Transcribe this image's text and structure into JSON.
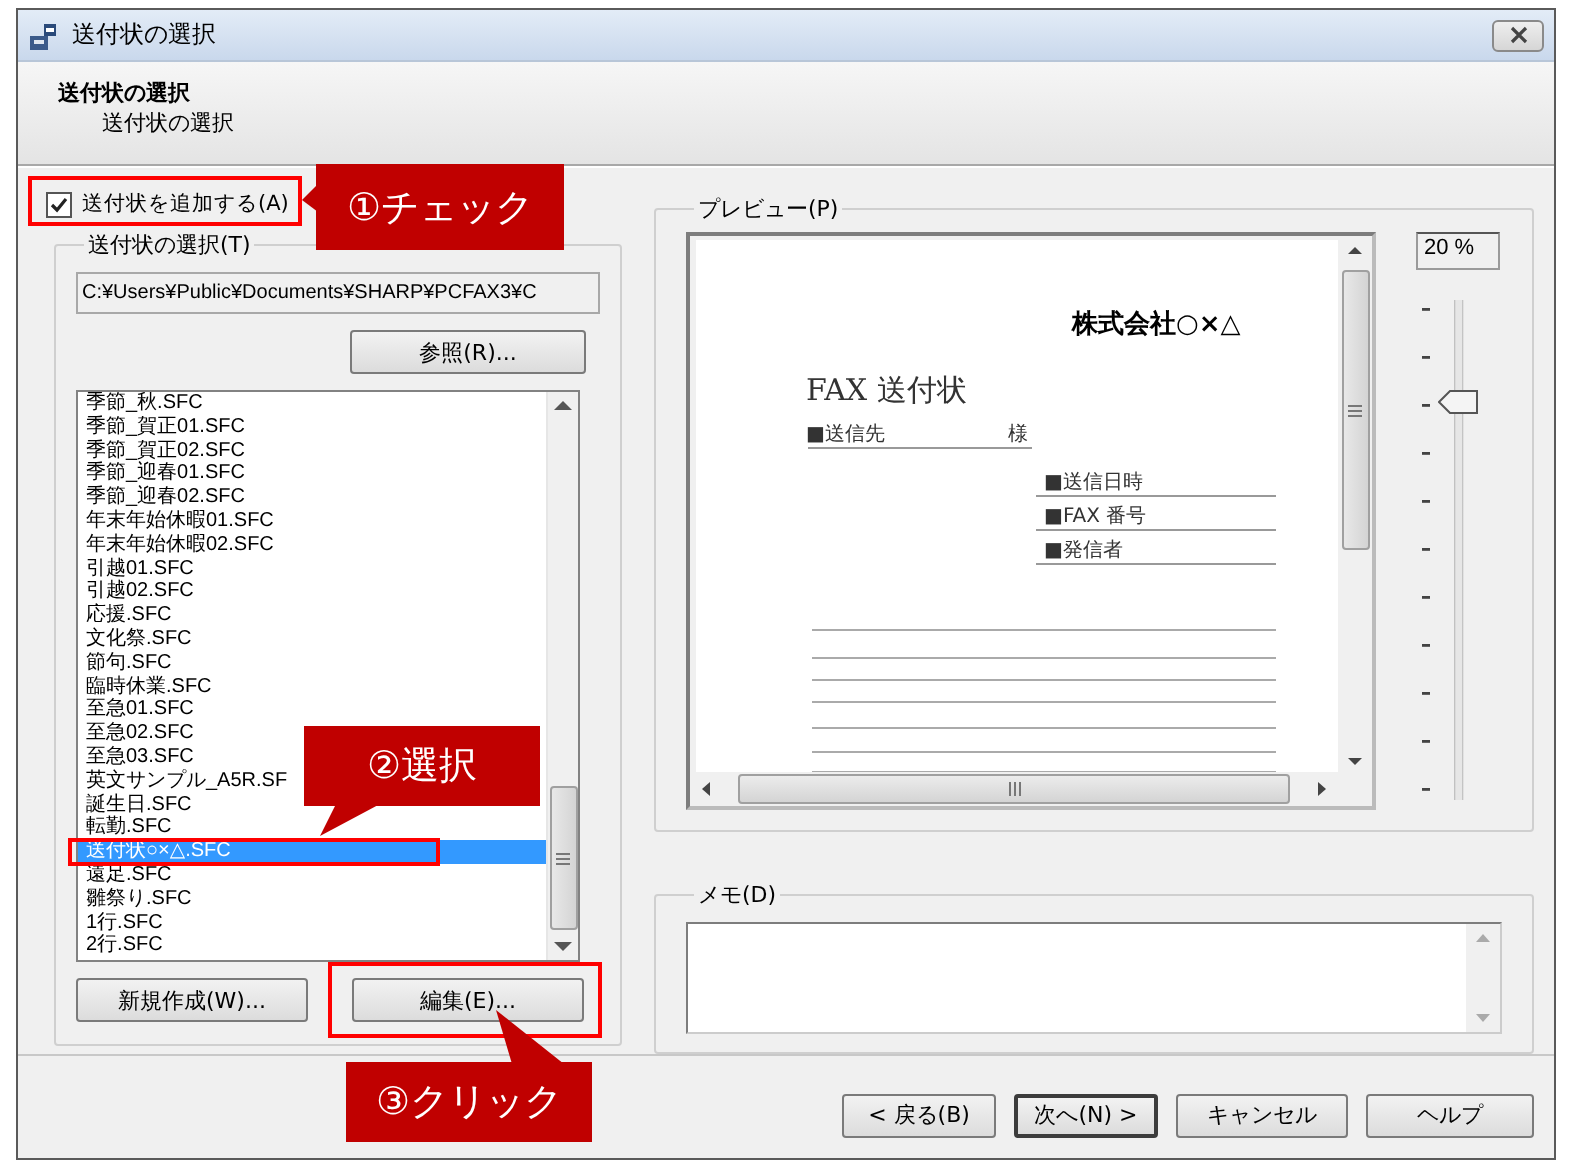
{
  "window": {
    "title": "送付状の選択"
  },
  "header": {
    "title": "送付状の選択",
    "subtitle": "送付状の選択"
  },
  "add_cover": {
    "label": "送付状を追加する(A)",
    "checked": true
  },
  "cover_group": {
    "label": "送付状の選択(T)",
    "path": "C:¥Users¥Public¥Documents¥SHARP¥PCFAX3¥C",
    "browse_button": "参照(R)...",
    "files": [
      {
        "name": "季節_秋.SFC",
        "selected": false
      },
      {
        "name": "季節_賀正01.SFC",
        "selected": false
      },
      {
        "name": "季節_賀正02.SFC",
        "selected": false
      },
      {
        "name": "季節_迎春01.SFC",
        "selected": false
      },
      {
        "name": "季節_迎春02.SFC",
        "selected": false
      },
      {
        "name": "年末年始休暇01.SFC",
        "selected": false
      },
      {
        "name": "年末年始休暇02.SFC",
        "selected": false
      },
      {
        "name": "引越01.SFC",
        "selected": false
      },
      {
        "name": "引越02.SFC",
        "selected": false
      },
      {
        "name": "応援.SFC",
        "selected": false
      },
      {
        "name": "文化祭.SFC",
        "selected": false
      },
      {
        "name": "節句.SFC",
        "selected": false
      },
      {
        "name": "臨時休業.SFC",
        "selected": false
      },
      {
        "name": "至急01.SFC",
        "selected": false
      },
      {
        "name": "至急02.SFC",
        "selected": false
      },
      {
        "name": "至急03.SFC",
        "selected": false
      },
      {
        "name": "英文サンプル_A5R.SF",
        "selected": false
      },
      {
        "name": "誕生日.SFC",
        "selected": false
      },
      {
        "name": "転勤.SFC",
        "selected": false
      },
      {
        "name": "送付状○×△.SFC",
        "selected": true
      },
      {
        "name": "遠足.SFC",
        "selected": false
      },
      {
        "name": "雛祭り.SFC",
        "selected": false
      },
      {
        "name": "1行.SFC",
        "selected": false
      },
      {
        "name": "2行.SFC",
        "selected": false
      }
    ],
    "buttons": [
      "新規作成(W)...",
      "編集(E)..."
    ]
  },
  "preview": {
    "label": "プレビュー(P)",
    "zoom": "20 %",
    "level": 0.81,
    "document": {
      "company": "株式会社○×△",
      "title": "FAX 送付状",
      "to": "■送信先",
      "honorific": "様",
      "fields": [
        "■送信日時",
        "■FAX 番号",
        "■発信者"
      ]
    }
  },
  "memo": {
    "label": "メモ(D)"
  },
  "nav_buttons": [
    {
      "label": "< 戻る(B)",
      "default": false
    },
    {
      "label": "次へ(N) >",
      "default": true
    },
    {
      "label": "キャンセル",
      "default": false
    },
    {
      "label": "ヘルプ",
      "default": false
    }
  ],
  "annotations": [
    {
      "text": "①チェック"
    },
    {
      "text": "②選択"
    },
    {
      "text": "③クリック"
    }
  ]
}
